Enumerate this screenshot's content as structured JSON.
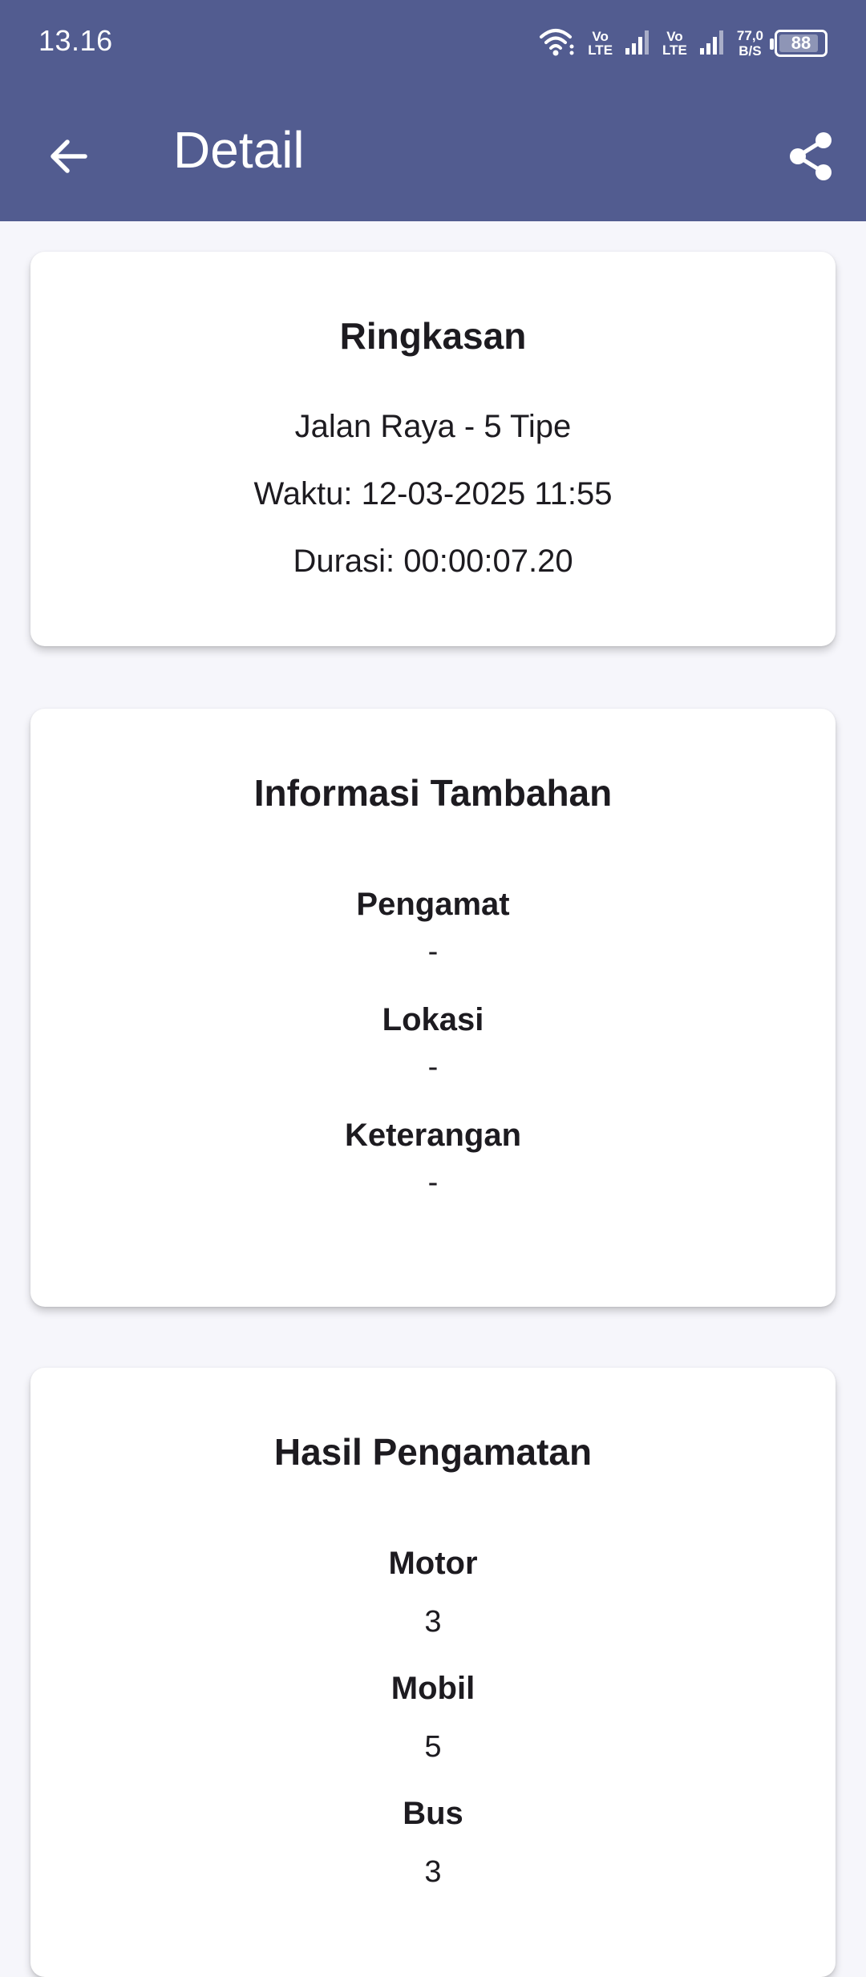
{
  "status_bar": {
    "time": "13.16",
    "volte_1": [
      "Vo",
      "LTE"
    ],
    "volte_2": [
      "Vo",
      "LTE"
    ],
    "net_speed": [
      "77,0",
      "B/S"
    ],
    "battery_level": "88",
    "icons": [
      "wifi-icon",
      "signal-icon",
      "battery-icon"
    ]
  },
  "app_bar": {
    "title": "Detail",
    "back_icon": "arrow-left-icon",
    "share_icon": "share-icon",
    "color": "#525c90"
  },
  "summary": {
    "title": "Ringkasan",
    "type": "Jalan Raya - 5 Tipe",
    "time": "Waktu: 12-03-2025 11:55",
    "duration": "Durasi: 00:00:07.20"
  },
  "additional_info": {
    "title": "Informasi Tambahan",
    "fields": [
      {
        "label": "Pengamat",
        "value": "-"
      },
      {
        "label": "Lokasi",
        "value": "-"
      },
      {
        "label": "Keterangan",
        "value": "-"
      }
    ]
  },
  "results": {
    "title": "Hasil Pengamatan",
    "items": [
      {
        "label": "Motor",
        "value": "3"
      },
      {
        "label": "Mobil",
        "value": "5"
      },
      {
        "label": "Bus",
        "value": "3"
      }
    ]
  }
}
